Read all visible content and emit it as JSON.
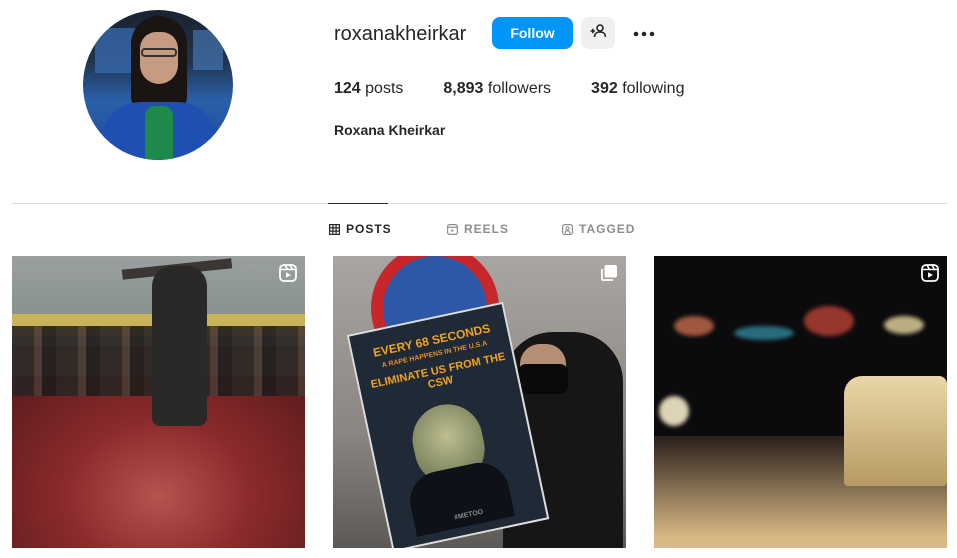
{
  "profile": {
    "username": "roxanakheirkar",
    "follow_label": "Follow",
    "full_name": "Roxana Kheirkar",
    "stats": {
      "posts_count": "124",
      "posts_label": "posts",
      "followers_count": "8,893",
      "followers_label": "followers",
      "following_count": "392",
      "following_label": "following"
    }
  },
  "tabs": [
    {
      "label": "POSTS",
      "icon": "grid-icon",
      "active": true
    },
    {
      "label": "REELS",
      "icon": "reels-icon",
      "active": false
    },
    {
      "label": "TAGGED",
      "icon": "tagged-icon",
      "active": false
    }
  ],
  "poster": {
    "line1": "EVERY 68 SECONDS",
    "line2": "A RAPE HAPPENS IN THE U.S.A",
    "line3": "ELIMINATE US FROM THE CSW",
    "tag": "#METOO"
  },
  "posts": [
    {
      "badge": "reels-icon"
    },
    {
      "badge": "carousel-icon"
    },
    {
      "badge": "reels-icon"
    }
  ],
  "colors": {
    "accent": "#0095f6",
    "text": "#262626",
    "muted": "#8e8e8e",
    "divider": "#dbdbdb"
  }
}
